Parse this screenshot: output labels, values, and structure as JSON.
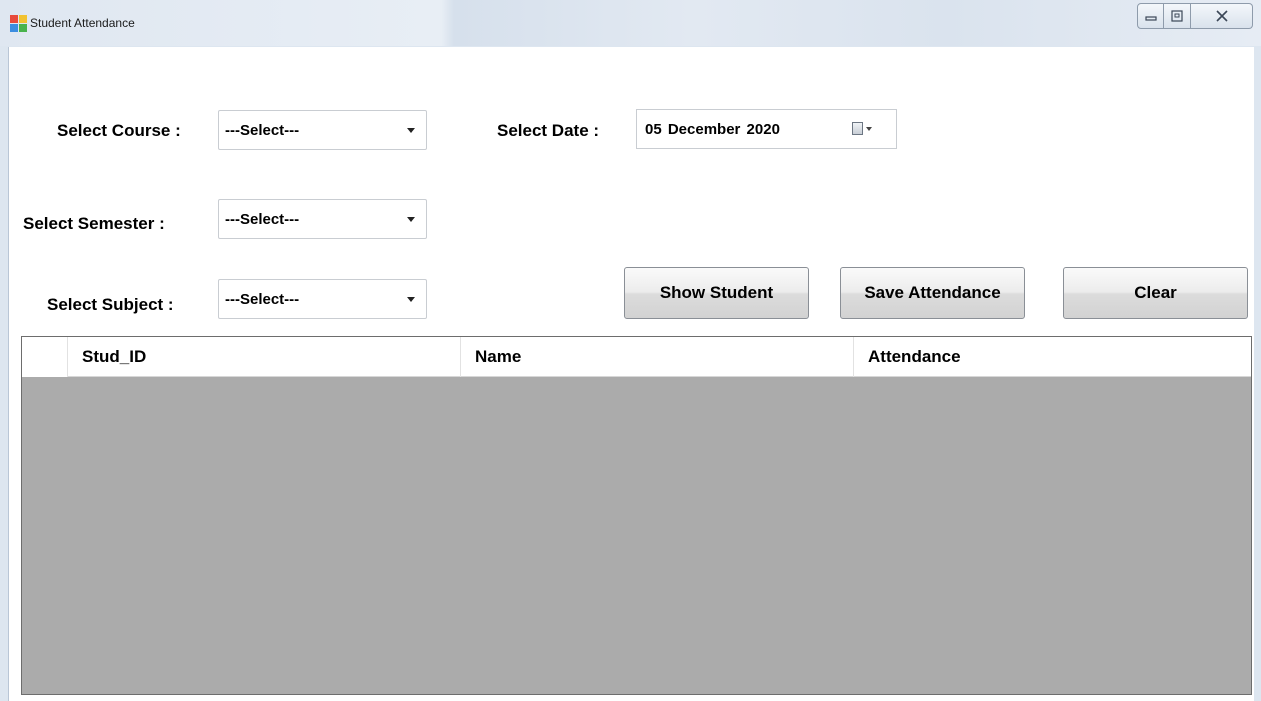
{
  "window": {
    "title": "Student Attendance",
    "buttons": {
      "minimize_icon": "minimize-icon",
      "maximize_icon": "maximize-icon",
      "close_icon": "close-icon"
    }
  },
  "form": {
    "course_label": "Select Course :",
    "course_value": "---Select---",
    "semester_label": "Select Semester :",
    "semester_value": "---Select---",
    "subject_label": "Select Subject  :",
    "subject_value": "---Select---",
    "date_label": "Select Date :",
    "date_value": "05  December  2020"
  },
  "actions": {
    "show_student": "Show Student",
    "save_attendance": "Save Attendance",
    "clear": "Clear"
  },
  "grid": {
    "columns": [
      "Stud_ID",
      "Name",
      "Attendance"
    ],
    "rows": []
  },
  "colors": {
    "grid_background": "#ababab",
    "button_face": "#e6e6e6",
    "window_frame": "#dde6f0"
  }
}
